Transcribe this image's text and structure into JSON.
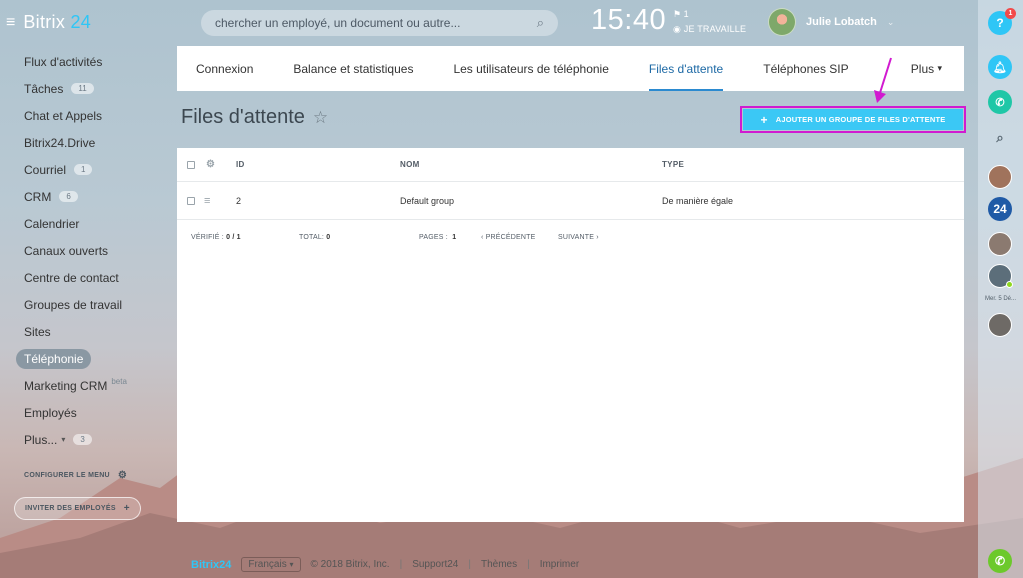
{
  "header": {
    "brand_name": "Bitrix",
    "brand_num": "24",
    "search_placeholder": "chercher un employé, un document ou autre...",
    "clock": "15:40",
    "flag_count": "1",
    "work_status": "JE TRAVAILLE",
    "user_name": "Julie Lobatch"
  },
  "sidebar": {
    "items": [
      {
        "label": "Flux d'activités"
      },
      {
        "label": "Tâches",
        "counter": "11"
      },
      {
        "label": "Chat et Appels"
      },
      {
        "label": "Bitrix24.Drive"
      },
      {
        "label": "Courriel",
        "counter": "1"
      },
      {
        "label": "CRM",
        "counter": "6"
      },
      {
        "label": "Calendrier"
      },
      {
        "label": "Canaux ouverts"
      },
      {
        "label": "Centre de contact"
      },
      {
        "label": "Groupes de travail"
      },
      {
        "label": "Sites"
      },
      {
        "label": "Téléphonie"
      },
      {
        "label": "Marketing CRM",
        "beta": "beta"
      },
      {
        "label": "Employés"
      },
      {
        "label": "Plus...",
        "counter": "3"
      }
    ],
    "configure_label": "CONFIGURER LE MENU",
    "invite_label": "INVITER DES EMPLOYÉS"
  },
  "tabs": [
    {
      "label": "Connexion"
    },
    {
      "label": "Balance et statistiques"
    },
    {
      "label": "Les utilisateurs de téléphonie"
    },
    {
      "label": "Files d'attente"
    },
    {
      "label": "Téléphones SIP"
    },
    {
      "label": "Plus"
    }
  ],
  "page": {
    "title": "Files d'attente",
    "add_button": "AJOUTER UN GROUPE DE FILES D'ATTENTE"
  },
  "grid": {
    "columns": [
      "ID",
      "NOM",
      "TYPE"
    ],
    "rows": [
      {
        "id": "2",
        "name": "Default group",
        "type": "De manière égale"
      }
    ],
    "footer": {
      "checked_label": "VÉRIFIÉ :",
      "checked_value": "0 / 1",
      "total_label": "TOTAL:",
      "total_value": "0",
      "pages_label": "PAGES :",
      "pages_value": "1",
      "prev": "PRÉCÉDENTE",
      "next": "SUIVANTE"
    }
  },
  "rightbar": {
    "help_badge": "1",
    "date_label": "Mer. 5 Dé..."
  },
  "footer": {
    "brand": "Bitrix24",
    "lang": "Français",
    "copyright": "© 2018 Bitrix, Inc.",
    "support": "Support24",
    "themes": "Thèmes",
    "print": "Imprimer"
  },
  "colors": {
    "accent": "#2fc6f6",
    "highlight_frame": "#d11ad0",
    "active_tab": "#1d69a5"
  }
}
